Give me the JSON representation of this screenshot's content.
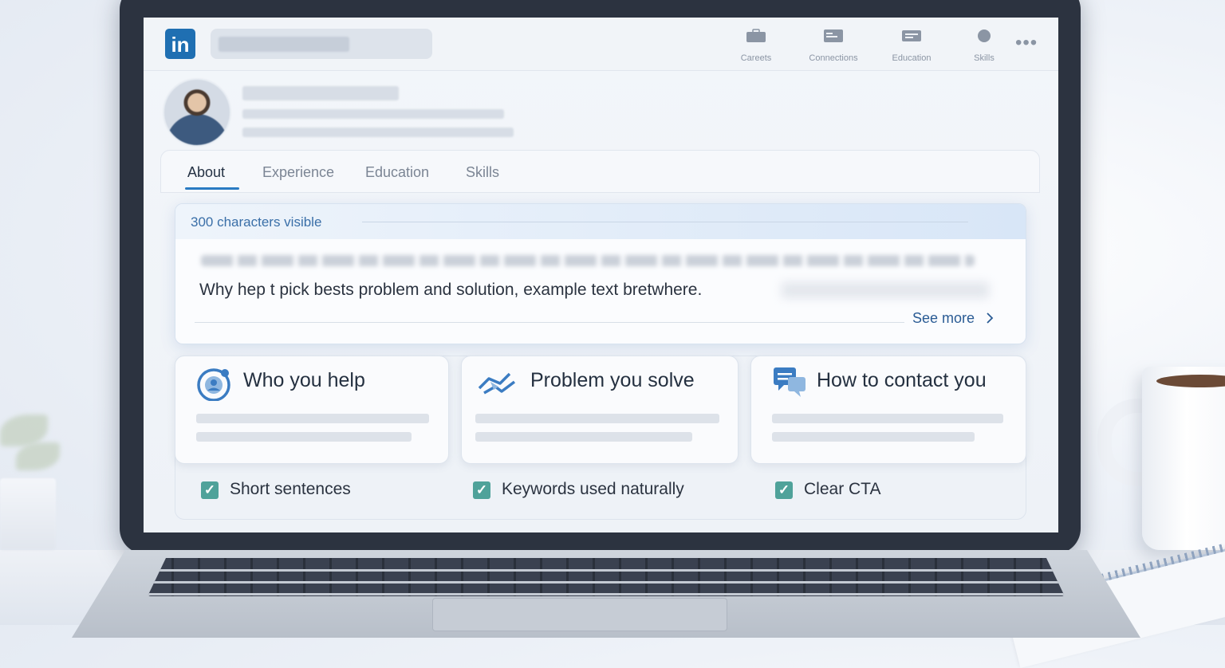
{
  "nav": {
    "items": [
      {
        "label": "Careets",
        "icon": "briefcase-icon"
      },
      {
        "label": "Connections",
        "icon": "connections-icon"
      },
      {
        "label": "Education",
        "icon": "education-icon"
      },
      {
        "label": "Skills",
        "icon": "skills-icon"
      }
    ],
    "more_label": "•••"
  },
  "logo": {
    "text": "in",
    "color": "#1f6fb2"
  },
  "tabs": [
    {
      "label": "About",
      "active": true
    },
    {
      "label": "Experience",
      "active": false
    },
    {
      "label": "Education",
      "active": false
    },
    {
      "label": "Skills",
      "active": false
    }
  ],
  "about": {
    "chars_label": "300 characters visible",
    "text": "Why hep t pick bests problem and solution, example text bretwhere.",
    "see_more": "See more",
    "see_more_icon": "chevron-right-icon"
  },
  "tips": [
    {
      "title": "Who you help",
      "icon": "target-person-icon"
    },
    {
      "title": "Problem you solve",
      "icon": "handshake-icon"
    },
    {
      "title": "How to contact you",
      "icon": "chat-bubbles-icon"
    }
  ],
  "checklist": [
    {
      "label": "Short sentences",
      "checked": true
    },
    {
      "label": "Keywords used naturally",
      "checked": true
    },
    {
      "label": "Clear CTA",
      "checked": true
    }
  ],
  "colors": {
    "accent": "#2a7bc2",
    "check": "#4fa29a",
    "bezel": "#2c3340"
  }
}
